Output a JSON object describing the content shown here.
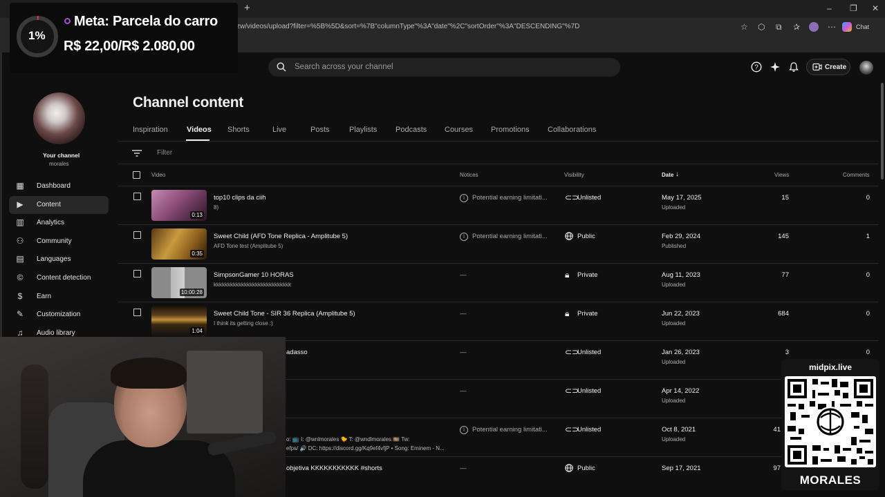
{
  "browser": {
    "new_tab": "+",
    "url": "zw/videos/upload?filter=%5B%5D&sort=%7B\"columnType\"%3A\"date\"%2C\"sortOrder\"%3A\"DESCENDING\"%7D",
    "chat_label": "Chat"
  },
  "goal_overlay": {
    "percent": "1%",
    "progress": 0.01,
    "title": "Meta: Parcela do carro",
    "amount": "R$ 22,00/R$ 2.080,00"
  },
  "header": {
    "search_placeholder": "Search across your channel",
    "create_label": "Create"
  },
  "sidebar": {
    "channel_label": "Your channel",
    "channel_name": "morales",
    "items": [
      {
        "label": "Dashboard",
        "icon": "dashboard-icon"
      },
      {
        "label": "Content",
        "icon": "content-icon",
        "active": true
      },
      {
        "label": "Analytics",
        "icon": "analytics-icon"
      },
      {
        "label": "Community",
        "icon": "community-icon"
      },
      {
        "label": "Languages",
        "icon": "languages-icon"
      },
      {
        "label": "Content detection",
        "icon": "copyright-icon"
      },
      {
        "label": "Earn",
        "icon": "earn-icon"
      },
      {
        "label": "Customization",
        "icon": "customization-icon"
      },
      {
        "label": "Audio library",
        "icon": "audio-library-icon"
      }
    ]
  },
  "main": {
    "title": "Channel content",
    "tabs": [
      "Inspiration",
      "Videos",
      "Shorts",
      "Live",
      "Posts",
      "Playlists",
      "Podcasts",
      "Courses",
      "Promotions",
      "Collaborations"
    ],
    "active_tab": "Videos",
    "filter_placeholder": "Filter",
    "columns": {
      "video": "Video",
      "notices": "Notices",
      "visibility": "Visibility",
      "date": "Date",
      "views": "Views",
      "comments": "Comments"
    },
    "rows": [
      {
        "title": "top10 clips da ciih",
        "desc": "8)",
        "duration": "0:13",
        "notice": "Potential earning limitati...",
        "visibility": "Unlisted",
        "vis_icon": "link-icon",
        "date": "May 17, 2025",
        "date_status": "Uploaded",
        "views": "15",
        "comments": "0"
      },
      {
        "title": "Sweet Child (AFD Tone Replica - Amplitube 5)",
        "desc": "AFD Tone test (Amplitube 5)",
        "duration": "0:35",
        "notice": "Potential earning limitati...",
        "visibility": "Public",
        "vis_icon": "globe-icon",
        "date": "Feb 29, 2024",
        "date_status": "Published",
        "views": "145",
        "comments": "1"
      },
      {
        "title": "SimpsonGamer 10 HORAS",
        "desc": "kkkkkkkkkkkkkkkkkkkkkkkkkkkk",
        "duration": "10:00:28",
        "notice": "—",
        "visibility": "Private",
        "vis_icon": "lock-icon",
        "date": "Aug 11, 2023",
        "date_status": "Uploaded",
        "views": "77",
        "comments": "0"
      },
      {
        "title": "Sweet Child Tone - SIR 36 Replica (Amplitube 5)",
        "desc": "I think its getting close :)",
        "duration": "1:04",
        "notice": "—",
        "visibility": "Private",
        "vis_icon": "lock-icon",
        "date": "Jun 22, 2023",
        "date_status": "Uploaded",
        "views": "684",
        "comments": "0"
      },
      {
        "title": "adasso",
        "desc": "",
        "duration": "",
        "notice": "—",
        "visibility": "Unlisted",
        "vis_icon": "link-icon",
        "date": "Jan 26, 2023",
        "date_status": "Uploaded",
        "views": "3",
        "comments": "0"
      },
      {
        "title": "",
        "desc": "",
        "duration": "",
        "notice": "—",
        "visibility": "Unlisted",
        "vis_icon": "link-icon",
        "date": "Apr 14, 2022",
        "date_status": "Uploaded",
        "views": "",
        "comments": ""
      },
      {
        "title": "",
        "desc": "o: 📺 I: @wnlmorales 🐤 T: @wndlmorales 🎞️ Tw:",
        "desc2": "efps/ 🔊 DC: https://discord.gg/Kq9ef4vfjP • Song: Eminem - N...",
        "duration": "",
        "notice": "Potential earning limitati...",
        "visibility": "Unlisted",
        "vis_icon": "link-icon",
        "date": "Oct 8, 2021",
        "date_status": "Uploaded",
        "views": "41",
        "comments": ""
      },
      {
        "title": "objetiva KKKKKKKKKKK #shorts",
        "desc": "",
        "duration": "",
        "notice": "—",
        "visibility": "Public",
        "vis_icon": "globe-icon",
        "date": "Sep 17, 2021",
        "date_status": "",
        "views": "97",
        "comments": ""
      }
    ]
  },
  "qr_overlay": {
    "site": "midpix.live",
    "brand": "MORALES"
  }
}
